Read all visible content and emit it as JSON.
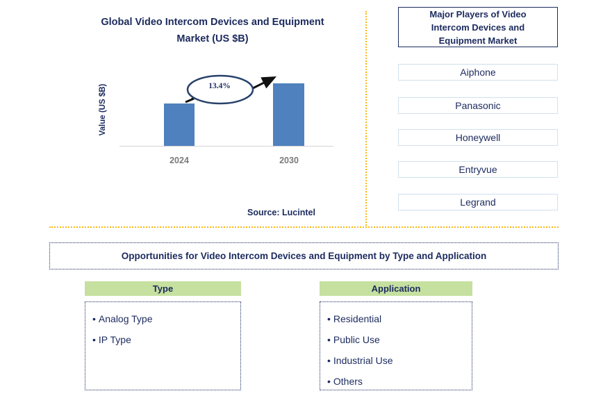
{
  "chart_panel": {
    "title": "Global Video Intercom Devices and Equipment Market (US $B)",
    "title_line1": "Global Video Intercom Devices and Equipment",
    "title_line2": "Market (US $B)",
    "source": "Source: Lucintel"
  },
  "chart_data": {
    "type": "bar",
    "title": "Global Video Intercom Devices and Equipment Market (US $B)",
    "categories": [
      "2024",
      "2030"
    ],
    "values": [
      61,
      90
    ],
    "value_unit": "relative bar height (px)",
    "xlabel": "",
    "ylabel": "Value (US $B)",
    "grid": false,
    "legend": null,
    "annotations": [
      {
        "text": "13.4%",
        "kind": "cagr-callout",
        "from": "2024",
        "to": "2030"
      }
    ],
    "tick_labels_x": [
      "2024",
      "2030"
    ],
    "tick_labels_y": [],
    "bar_color": "#4e81bd"
  },
  "players_panel": {
    "header": "Major Players of Video Intercom Devices and Equipment Market",
    "header_line1": "Major Players of Video",
    "header_line2": "Intercom Devices and",
    "header_line3": "Equipment Market",
    "players": [
      "Aiphone",
      "Panasonic",
      "Honeywell",
      "Entryvue",
      "Legrand"
    ]
  },
  "opportunities": {
    "banner": "Opportunities for Video Intercom Devices and Equipment by Type and Application",
    "columns": [
      {
        "header": "Type",
        "items": [
          "Analog Type",
          "IP Type"
        ]
      },
      {
        "header": "Application",
        "items": [
          "Residential",
          "Public Use",
          "Industrial Use",
          "Others"
        ]
      }
    ]
  },
  "colors": {
    "navy": "#1b2a5e",
    "bar_blue": "#4e81bd",
    "gold_divider": "#fcb813",
    "green_header": "#c6e0a0",
    "player_box_border": "#cfe0ef",
    "axis_gray": "#7b7b7b"
  },
  "bullet": "•"
}
